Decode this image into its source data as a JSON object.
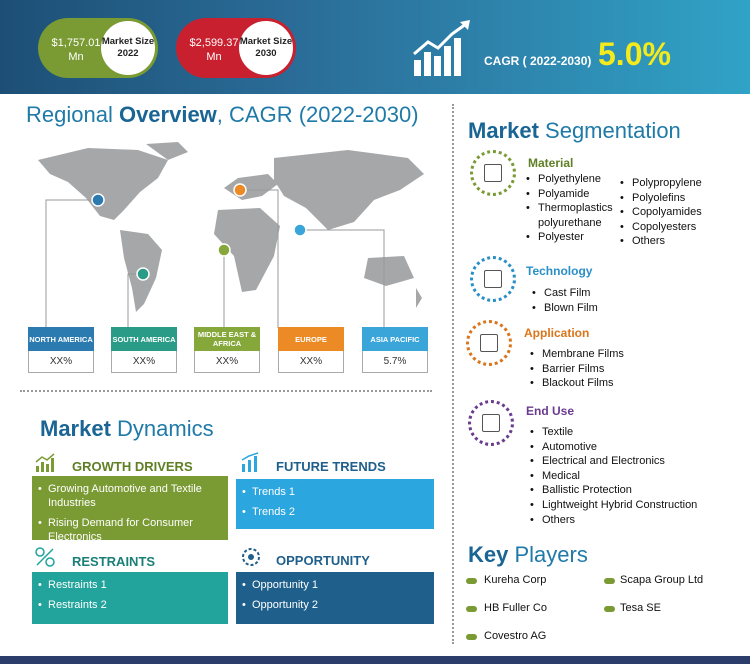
{
  "header": {
    "market_2022": {
      "value": "$1,757.01 Mn",
      "label": "Market Size 2022"
    },
    "market_2030": {
      "value": "$2,599.37 Mn",
      "label": "Market Size 2030"
    },
    "cagr_label": "CAGR ( 2022-2030)",
    "cagr_value": "5.0%"
  },
  "regional": {
    "title_light": "Regional ",
    "title_bold": "Overview",
    "title_rest": ", CAGR (2022-2030)",
    "regions": [
      {
        "name": "NORTH AMERICA",
        "value": "XX%",
        "color": "#2b7bb1"
      },
      {
        "name": "SOUTH AMERICA",
        "value": "XX%",
        "color": "#2a9b86"
      },
      {
        "name": "MIDDLE EAST & AFRICA",
        "value": "XX%",
        "color": "#86a83a"
      },
      {
        "name": "EUROPE",
        "value": "XX%",
        "color": "#ec8a25"
      },
      {
        "name": "ASIA PACIFIC",
        "value": "5.7%",
        "color": "#39a5d8"
      }
    ]
  },
  "dynamics": {
    "title_bold": "Market",
    "title_rest": " Dynamics",
    "growth_drivers": {
      "title": "GROWTH DRIVERS",
      "color": "#7a9a33",
      "items": [
        "Growing Automotive and Textile Industries",
        "Rising Demand for Consumer Electronics"
      ]
    },
    "future_trends": {
      "title": "FUTURE TRENDS",
      "color": "#2ba6df",
      "items": [
        "Trends 1",
        "Trends 2"
      ]
    },
    "restraints": {
      "title": "RESTRAINTS",
      "color": "#22a39b",
      "items": [
        "Restraints 1",
        "Restraints 2"
      ]
    },
    "opportunity": {
      "title": "OPPORTUNITY",
      "color": "#1f5f8b",
      "items": [
        "Opportunity 1",
        "Opportunity 2"
      ]
    }
  },
  "segmentation": {
    "title_bold": "Market",
    "title_rest": " Segmentation",
    "material": {
      "title": "Material",
      "color": "#5e7f24",
      "col1": [
        "Polyethylene",
        "Polyamide",
        "Thermoplastics polyurethane",
        "Polyester"
      ],
      "col2": [
        "Polypropylene",
        "Polyolefins",
        "Copolyamides",
        "Copolyesters",
        "Others"
      ]
    },
    "technology": {
      "title": "Technology",
      "color": "#2a8fc7",
      "items": [
        "Cast Film",
        "Blown Film"
      ]
    },
    "application": {
      "title": "Application",
      "color": "#d9751a",
      "items": [
        "Membrane Films",
        "Barrier Films",
        "Blackout Films"
      ]
    },
    "end_use": {
      "title": "End Use",
      "color": "#6a3b8f",
      "items": [
        "Textile",
        "Automotive",
        "Electrical and Electronics",
        "Medical",
        "Ballistic Protection",
        "Lightweight Hybrid Construction",
        "Others"
      ]
    }
  },
  "key_players": {
    "title_bold": "Key",
    "title_rest": " Players",
    "players": [
      "Kureha Corp",
      "Scapa Group Ltd",
      "HB Fuller Co",
      "Tesa SE",
      "Covestro AG"
    ]
  }
}
